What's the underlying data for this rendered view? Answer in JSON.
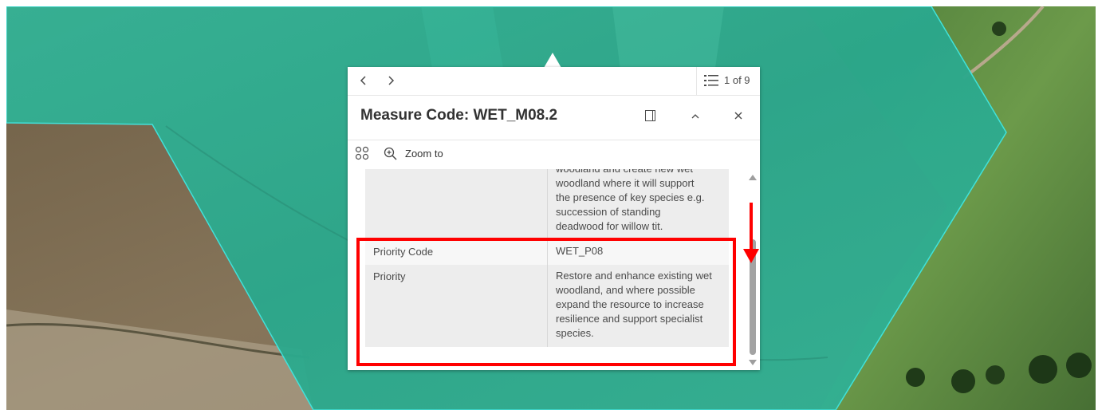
{
  "colors": {
    "overlay_fill": "#2fae93",
    "overlay_outline": "#3fe6e0",
    "highlight": "#ff0000",
    "field_label_bg_shaded": "#ededed",
    "field_label_bg_plain": "#f7f7f7"
  },
  "popup": {
    "nav": {
      "prev_icon": "chevron-left-icon",
      "next_icon": "chevron-right-icon",
      "list_icon": "feature-list-icon",
      "count": "1 of 9"
    },
    "title": "Measure Code: WET_M08.2",
    "header_actions": {
      "dock_icon": "dock-panel-icon",
      "collapse_icon": "chevron-up-icon",
      "close_icon": "close-icon"
    },
    "actions": {
      "more_icon": "grid-dots-icon",
      "zoom_icon": "zoom-in-icon",
      "zoom_label": "Zoom to"
    },
    "fields": [
      {
        "label": "",
        "value": "woodland and create new wet\nwoodland where it will support\nthe presence of key species e.g.\nsuccession of standing\ndeadwood for willow tit."
      },
      {
        "label": "Priority Code",
        "value": "WET_P08"
      },
      {
        "label": "Priority",
        "value": "Restore and enhance existing wet\nwoodland, and where possible\nexpand the resource to increase\nresilience and support specialist\nspecies."
      }
    ]
  }
}
